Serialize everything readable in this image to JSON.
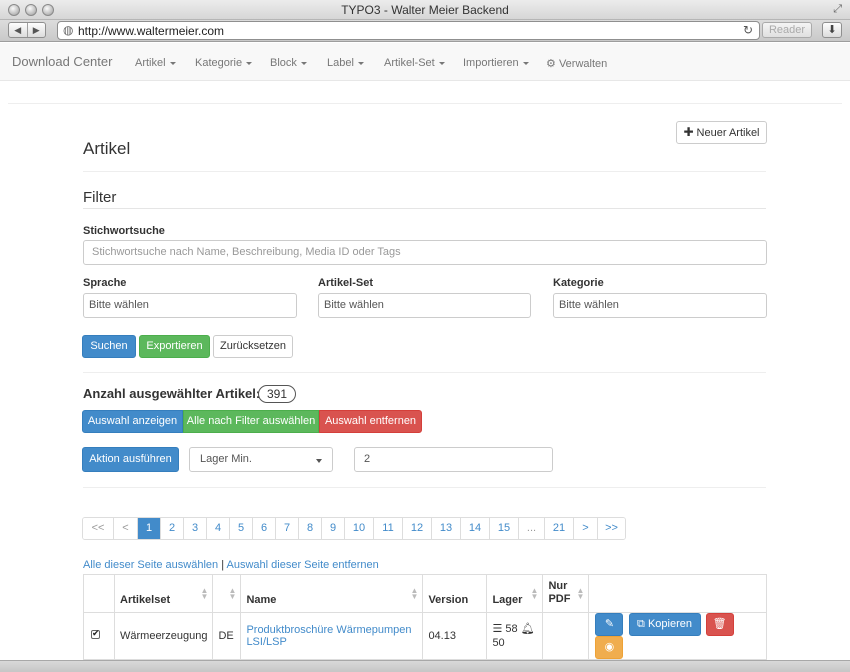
{
  "browser": {
    "window_title": "TYPO3 - Walter Meier Backend",
    "url": "http://www.waltermeier.com",
    "reader_label": "Reader",
    "back_glyph": "◀",
    "forward_glyph": "▶",
    "reload_glyph": "↻",
    "globe_glyph": "◍",
    "download_glyph": "⬇",
    "resize_glyph": "⤢"
  },
  "navbar": {
    "brand": "Download Center",
    "items": [
      {
        "label": "Artikel"
      },
      {
        "label": "Kategorie"
      },
      {
        "label": "Block"
      },
      {
        "label": "Label"
      },
      {
        "label": "Artikel-Set"
      },
      {
        "label": "Importieren"
      }
    ],
    "verwalten": "Verwalten",
    "gear_glyph": "⚙"
  },
  "page": {
    "title": "Artikel",
    "new_button": "Neuer Artikel",
    "filter_title": "Filter",
    "keyword_label": "Stichwortsuche",
    "keyword_placeholder": "Stichwortsuche nach Name, Beschreibung, Media ID oder Tags",
    "sprache_label": "Sprache",
    "sprache_value": "Bitte wählen",
    "artikelset_label": "Artikel-Set",
    "artikelset_value": "Bitte wählen",
    "kategorie_label": "Kategorie",
    "kategorie_value": "Bitte wählen",
    "btn_search": "Suchen",
    "btn_export": "Exportieren",
    "btn_reset": "Zurücksetzen",
    "selected_label": "Anzahl ausgewählter Artikel:",
    "selected_count": "391",
    "btn_show_selection": "Auswahl anzeigen",
    "btn_select_all_filter": "Alle nach Filter auswählen",
    "btn_remove_selection": "Auswahl entfernen",
    "btn_action": "Aktion ausführen",
    "action_select_value": "Lager Min.",
    "action_input_value": "2"
  },
  "pagination": [
    "<<",
    "<",
    "1",
    "2",
    "3",
    "4",
    "5",
    "6",
    "7",
    "8",
    "9",
    "10",
    "11",
    "12",
    "13",
    "14",
    "15",
    "...",
    "21",
    ">",
    ">>"
  ],
  "pagination_active": "1",
  "links": {
    "select_page": "Alle dieser Seite auswählen",
    "separator": "|",
    "deselect_page": "Auswahl dieser Seite entfernen"
  },
  "table": {
    "headers": {
      "artikelset": "Artikelset",
      "name": "Name",
      "version": "Version",
      "lager": "Lager",
      "nur_pdf_1": "Nur",
      "nur_pdf_2": "PDF"
    },
    "rows": [
      {
        "artikelset": "Wärmeerzeugung",
        "lang": "DE",
        "name_line1": "Produktbroschüre Wärmepumpen",
        "name_line2": "LSI/LSP",
        "version": "04.13",
        "lager_stock": "58",
        "lager_min": "50",
        "btn_copy": "Kopieren"
      }
    ]
  },
  "colors": {
    "primary": "#428bca",
    "success": "#5cb85c",
    "danger": "#d9534f",
    "warning": "#f0ad4e"
  }
}
